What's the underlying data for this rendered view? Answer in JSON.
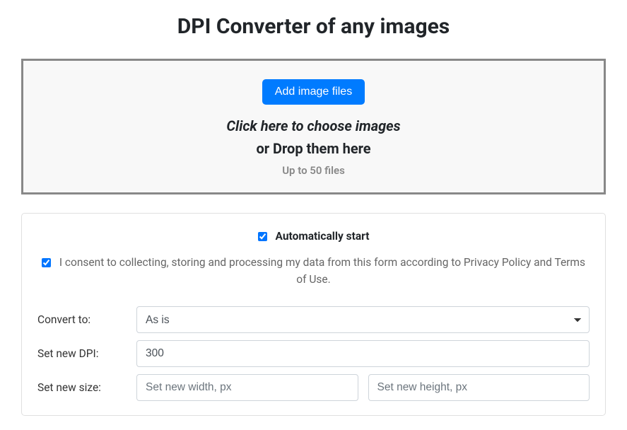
{
  "title": "DPI Converter of any images",
  "dropzone": {
    "button": "Add image files",
    "line1": "Click here to choose images",
    "line2": "or Drop them here",
    "line3": "Up to 50 files"
  },
  "options": {
    "auto_start_label": "Automatically start",
    "consent_label": "I consent to collecting, storing and processing my data from this form according to Privacy Policy and Terms of Use."
  },
  "form": {
    "convert_to_label": "Convert to:",
    "convert_to_value": "As is",
    "dpi_label": "Set new DPI:",
    "dpi_value": "300",
    "size_label": "Set new size:",
    "width_placeholder": "Set new width, px",
    "height_placeholder": "Set new height, px"
  }
}
